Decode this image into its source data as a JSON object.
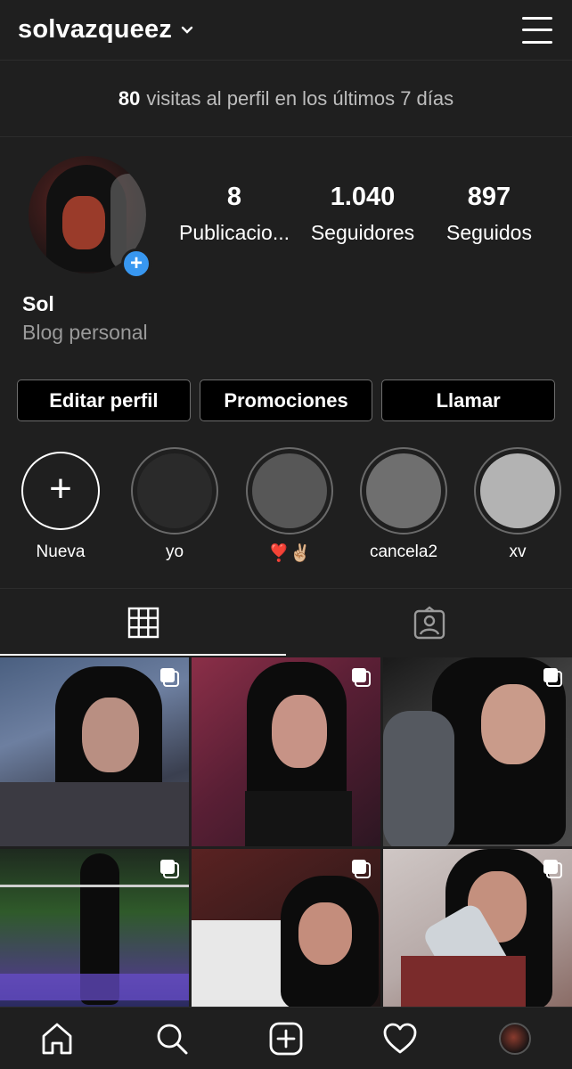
{
  "header": {
    "username": "solvazqueez",
    "chevron_icon": "chevron-down-icon",
    "menu_icon": "hamburger-menu-icon"
  },
  "visits": {
    "count": "80",
    "text": "visitas al perfil en los últimos 7 días"
  },
  "profile": {
    "stats": [
      {
        "value": "8",
        "label": "Publicacio..."
      },
      {
        "value": "1.040",
        "label": "Seguidores"
      },
      {
        "value": "897",
        "label": "Seguidos"
      }
    ],
    "name": "Sol",
    "category": "Blog personal",
    "add_story_icon": "plus-icon"
  },
  "buttons": {
    "edit": "Editar perfil",
    "promotions": "Promociones",
    "call": "Llamar"
  },
  "highlights": [
    {
      "label": "Nueva",
      "color": "#1f1f1f"
    },
    {
      "label": "yo",
      "color": "#2a2a2a"
    },
    {
      "label": "❣️✌🏼",
      "color": "#575757"
    },
    {
      "label": "cancela2",
      "color": "#6f6f6f"
    },
    {
      "label": "xv",
      "color": "#b3b3b3"
    }
  ],
  "tabs": [
    {
      "name": "grid-icon",
      "active": true
    },
    {
      "name": "tagged-icon",
      "active": false
    }
  ],
  "posts_icon": "multiple-photos-icon",
  "bottom_nav": [
    "home-icon",
    "search-icon",
    "new-post-icon",
    "heart-icon",
    "profile-avatar"
  ],
  "colors": {
    "background": "#1f1f1f",
    "accent": "#3897f0",
    "muted_text": "#9a9a9a"
  }
}
